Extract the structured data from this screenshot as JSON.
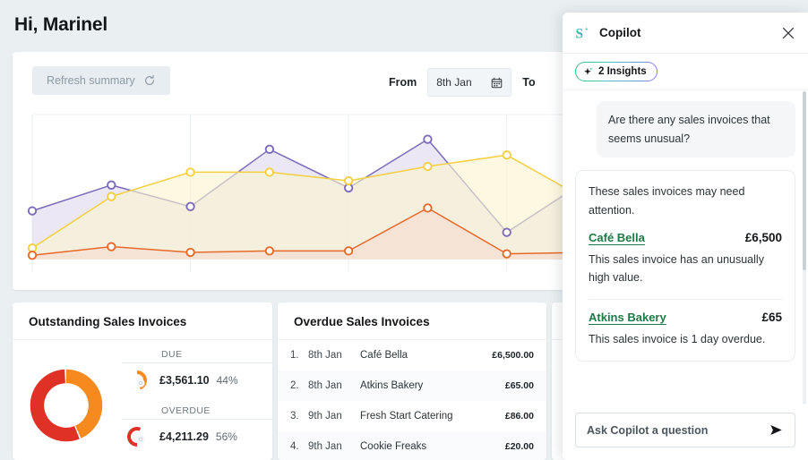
{
  "page": {
    "greeting": "Hi, Marinel",
    "bg": "#eaf0f1"
  },
  "summary": {
    "refresh_label": "Refresh summary",
    "refresh_icon": "refresh-icon",
    "from_label": "From",
    "from_value": "8th Jan",
    "to_label": "To",
    "calendar_icon": "calendar-icon"
  },
  "chart_data": {
    "type": "area",
    "title": "",
    "xlabel": "",
    "ylabel": "",
    "grid": true,
    "legend": "none",
    "x": [
      1,
      2,
      3,
      4,
      5,
      6,
      7,
      8
    ],
    "ylim": [
      0,
      100
    ],
    "series": [
      {
        "name": "Purple",
        "color": "#7d6bb8",
        "fill": "#ded9ef",
        "values": [
          34,
          52,
          37,
          77,
          50,
          84,
          19,
          55
        ]
      },
      {
        "name": "Yellow",
        "color": "#f3d03f",
        "fill": "#fbf3cf",
        "values": [
          8,
          44,
          61,
          61,
          55,
          65,
          73,
          42
        ]
      },
      {
        "name": "Orange",
        "color": "#e8692a",
        "fill": "#f6ddd0",
        "values": [
          3,
          9,
          5,
          6,
          6,
          36,
          4,
          5
        ]
      }
    ]
  },
  "outstanding": {
    "title": "Outstanding Sales Invoices",
    "donut": [
      {
        "label": "DUE",
        "amount": "£3,561.10",
        "percent": "44%",
        "value": 44,
        "color": "#f68a1f"
      },
      {
        "label": "OVERDUE",
        "amount": "£4,211.29",
        "percent": "56%",
        "value": 56,
        "color": "#e03127"
      }
    ]
  },
  "overdue": {
    "title": "Overdue Sales Invoices",
    "rows": [
      {
        "index": "1.",
        "date": "8th Jan",
        "name": "Café Bella",
        "amount": "£6,500.00"
      },
      {
        "index": "2.",
        "date": "8th Jan",
        "name": "Atkins Bakery",
        "amount": "£65.00"
      },
      {
        "index": "3.",
        "date": "9th Jan",
        "name": "Fresh Start Catering",
        "amount": "£86.00"
      },
      {
        "index": "4.",
        "date": "9th Jan",
        "name": "Cookie Freaks",
        "amount": "£20.00"
      }
    ]
  },
  "third_panel": {
    "donut_colors": [
      "#fbc02d",
      "#f29100"
    ]
  },
  "copilot": {
    "logo_icon": "copilot-s-icon",
    "title": "Copilot",
    "close_icon": "close-icon",
    "insights_badge": "2 Insights",
    "sparkle_icon": "sparkle-icon",
    "user_message": "Are there any sales invoices that seems unusual?",
    "bot_intro": "These sales invoices may need attention.",
    "insights": [
      {
        "name": "Café Bella",
        "amount": "£6,500",
        "description": "This sales invoice has an unusually high value."
      },
      {
        "name": "Atkins Bakery",
        "amount": "£65",
        "description": "This sales invoice is 1 day overdue."
      }
    ],
    "ask_placeholder": "Ask Copilot a question",
    "send_icon": "send-icon",
    "link_color": "#1b7a45"
  }
}
